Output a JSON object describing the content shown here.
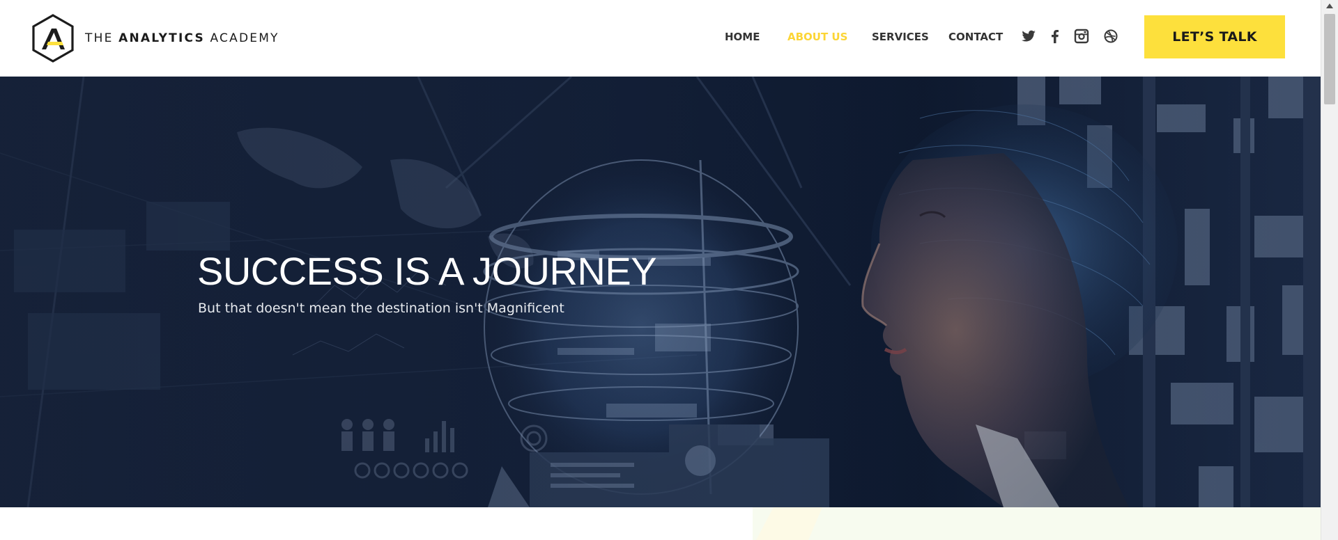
{
  "brand": {
    "word1": "THE",
    "word2": "ANALYTICS",
    "word3": "ACADEMY",
    "colors": {
      "accent": "#fde03c",
      "nav_active": "#fcd535",
      "hero_overlay": "#0f1a2d"
    }
  },
  "nav": {
    "items": [
      {
        "label": "HOME",
        "active": false
      },
      {
        "label": "ABOUT US",
        "active": true
      },
      {
        "label": "SERVICES",
        "active": false
      },
      {
        "label": "CONTACT",
        "active": false
      }
    ],
    "social": [
      "twitter-icon",
      "facebook-icon",
      "instagram-icon",
      "dribbble-icon"
    ],
    "cta_label": "LET’S TALK"
  },
  "hero": {
    "title": "SUCCESS IS A JOURNEY",
    "subtitle": "But that doesn't mean the destination isn't Magnificent"
  }
}
